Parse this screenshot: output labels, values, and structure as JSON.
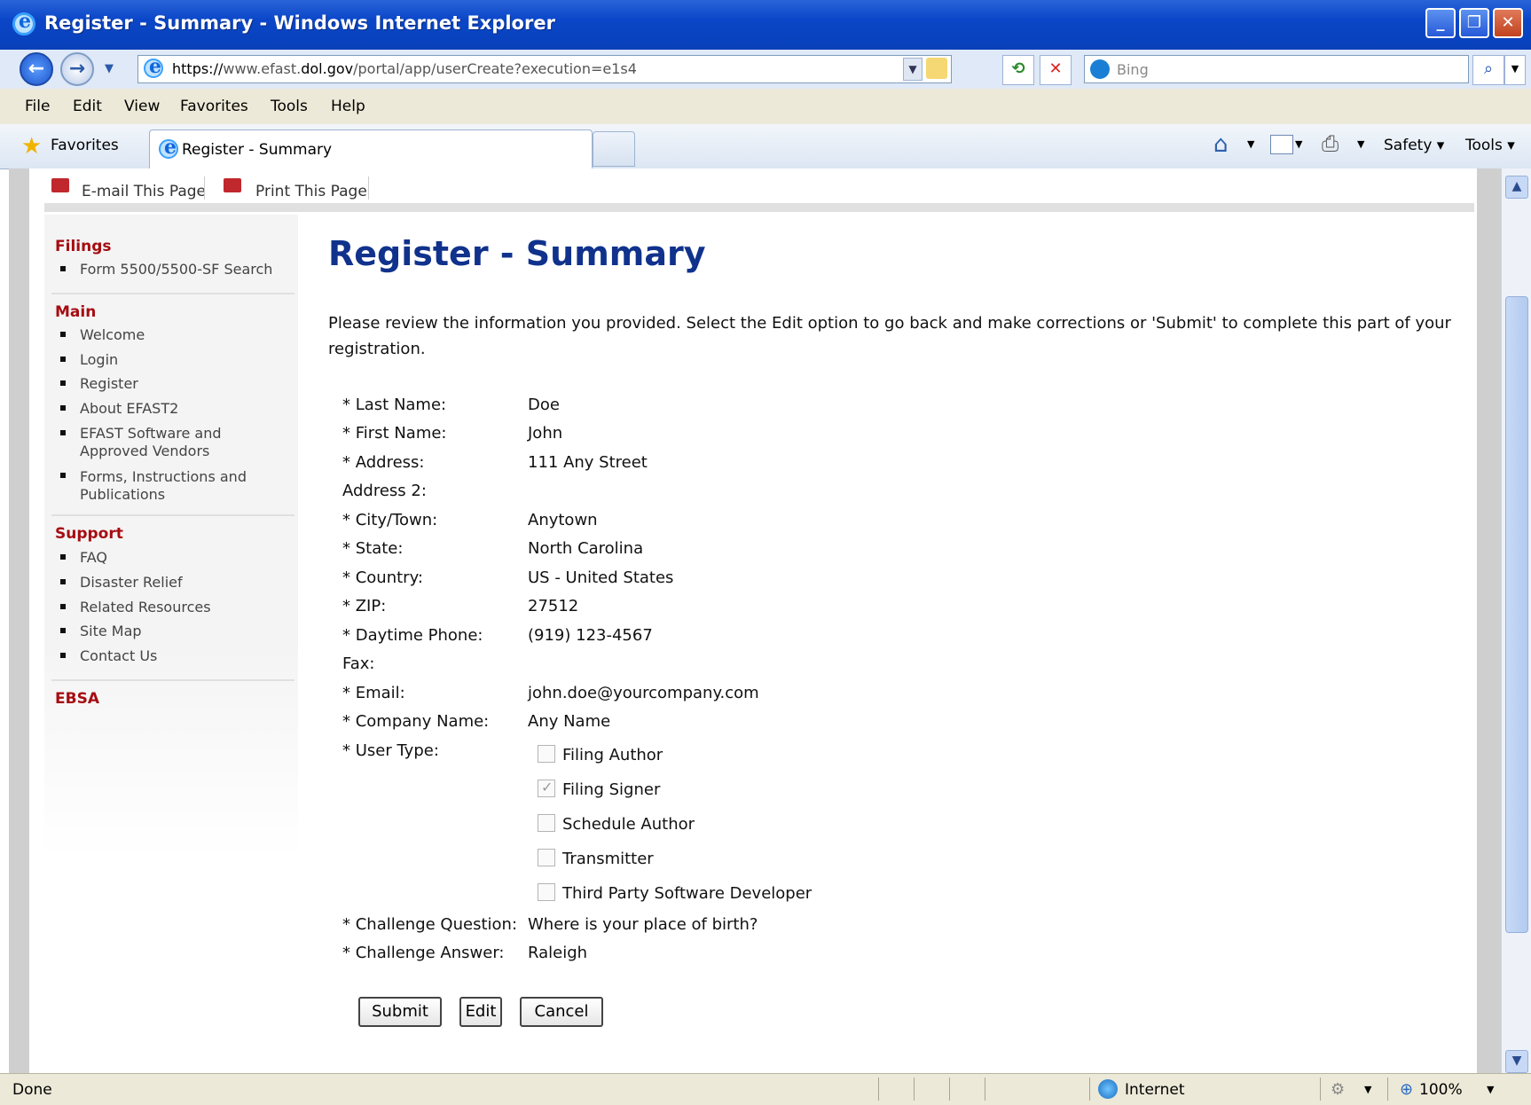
{
  "window": {
    "title": "Register - Summary - Windows Internet Explorer"
  },
  "addressbar": {
    "url_prefix": "https://",
    "url_host_pre": "www.efast.",
    "url_domain": "dol.gov",
    "url_path": "/portal/app/userCreate?execution=e1s4",
    "search_placeholder": "Bing"
  },
  "menubar": [
    "File",
    "Edit",
    "View",
    "Favorites",
    "Tools",
    "Help"
  ],
  "favbar": {
    "favorites_label": "Favorites",
    "tab_label": "Register - Summary",
    "commands": [
      "Safety ▾",
      "Tools ▾"
    ]
  },
  "toplinks": {
    "email": "E-mail This Page",
    "print": "Print This Page"
  },
  "sidebar": {
    "sections": [
      {
        "heading": "Filings",
        "items": [
          "Form 5500/5500-SF Search"
        ]
      },
      {
        "heading": "Main",
        "items": [
          "Welcome",
          "Login",
          "Register",
          "About EFAST2",
          "EFAST Software and Approved Vendors",
          "Forms, Instructions and Publications"
        ]
      },
      {
        "heading": "Support",
        "items": [
          "FAQ",
          "Disaster Relief",
          "Related Resources",
          "Site Map",
          "Contact Us"
        ]
      },
      {
        "heading": "EBSA",
        "items": []
      }
    ]
  },
  "main": {
    "title": "Register - Summary",
    "intro": "Please review the information you provided. Select the Edit option to go back and make corrections or 'Submit' to complete this part of your registration.",
    "fields": [
      {
        "label": "* Last Name:",
        "value": "Doe"
      },
      {
        "label": "* First Name:",
        "value": "John"
      },
      {
        "label": "* Address:",
        "value": "111 Any Street"
      },
      {
        "label": "Address 2:",
        "value": ""
      },
      {
        "label": "* City/Town:",
        "value": "Anytown"
      },
      {
        "label": "* State:",
        "value": "North Carolina"
      },
      {
        "label": "* Country:",
        "value": "US - United States"
      },
      {
        "label": "* ZIP:",
        "value": "27512"
      },
      {
        "label": "* Daytime Phone:",
        "value": "(919) 123-4567"
      },
      {
        "label": "Fax:",
        "value": ""
      },
      {
        "label": "* Email:",
        "value": "john.doe@yourcompany.com"
      },
      {
        "label": "* Company Name:",
        "value": "Any Name"
      }
    ],
    "user_type_label": "* User Type:",
    "user_types": [
      {
        "label": "Filing Author",
        "checked": false
      },
      {
        "label": "Filing Signer",
        "checked": true
      },
      {
        "label": "Schedule Author",
        "checked": false
      },
      {
        "label": "Transmitter",
        "checked": false
      },
      {
        "label": "Third Party Software Developer",
        "checked": false
      }
    ],
    "challenge": [
      {
        "label": "* Challenge Question:",
        "value": "Where is your place of birth?"
      },
      {
        "label": "* Challenge Answer:",
        "value": "Raleigh"
      }
    ],
    "buttons": {
      "submit": "Submit",
      "edit": "Edit",
      "cancel": "Cancel"
    }
  },
  "statusbar": {
    "status": "Done",
    "zone": "Internet",
    "zoom": "100%"
  }
}
